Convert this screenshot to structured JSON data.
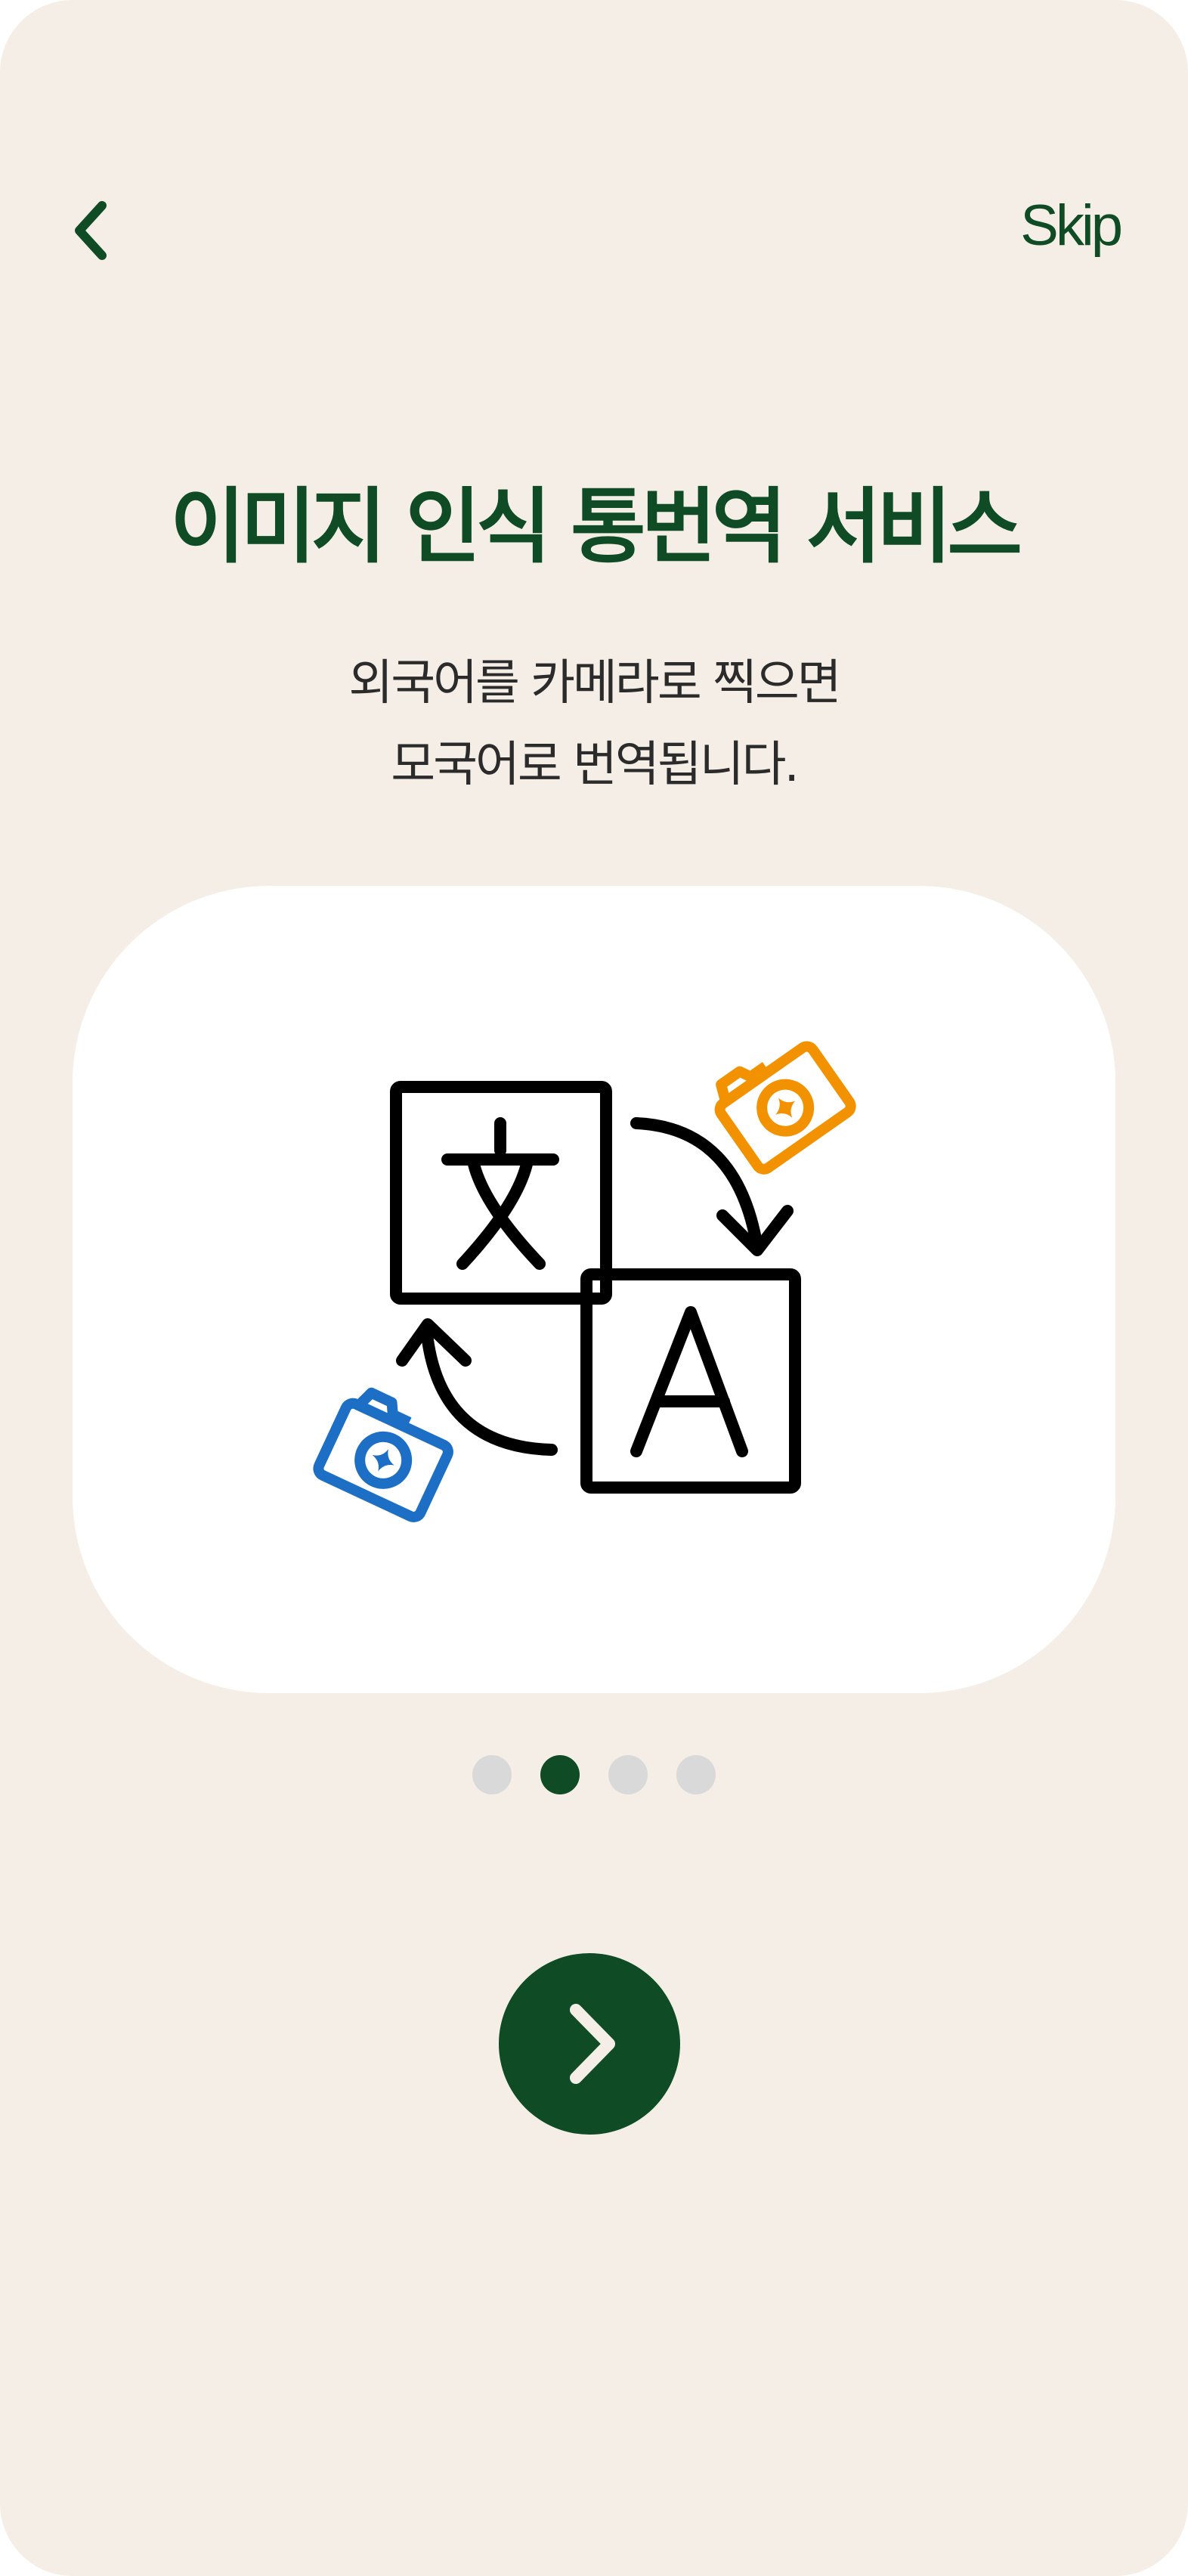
{
  "nav": {
    "back_icon": "chevron-left-icon",
    "skip_label": "Skip"
  },
  "onboarding": {
    "title": "이미지 인식 통번역 서비스",
    "description_line1": "외국어를 카메라로 찍으면",
    "description_line2": "모국어로 번역됩니다.",
    "illustration_icon": "translate-camera-icon",
    "current_page": 2,
    "total_pages": 4
  },
  "next_button": {
    "icon": "chevron-right-icon"
  },
  "colors": {
    "background": "#f4eee6",
    "primary": "#0f4c25",
    "card": "#ffffff",
    "dot_inactive": "#d9d9d9",
    "camera_orange": "#f39200",
    "camera_blue": "#1c6fc4"
  }
}
